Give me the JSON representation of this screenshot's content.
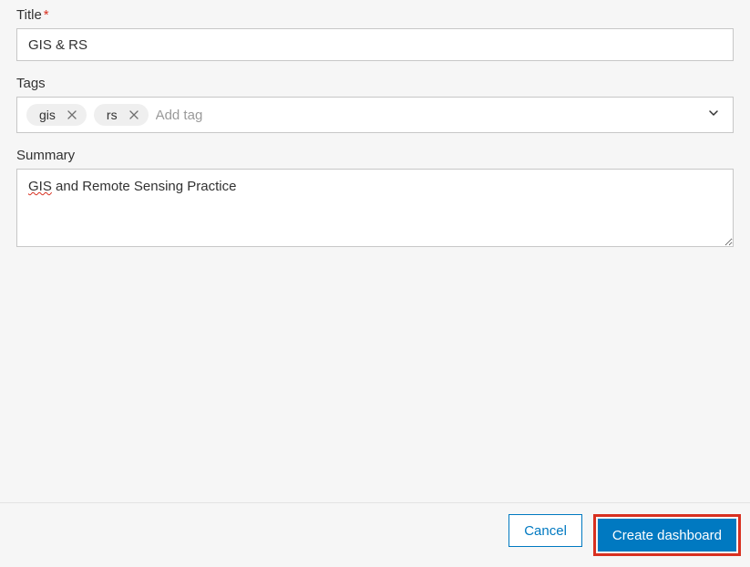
{
  "form": {
    "title": {
      "label": "Title",
      "required_marker": "*",
      "value": "GIS & RS"
    },
    "tags": {
      "label": "Tags",
      "items": [
        {
          "text": "gis"
        },
        {
          "text": "rs"
        }
      ],
      "placeholder": "Add tag"
    },
    "summary": {
      "label": "Summary",
      "value_spellcheck_part": "GIS",
      "value_rest": " and Remote Sensing Practice"
    }
  },
  "footer": {
    "cancel": "Cancel",
    "create": "Create dashboard"
  }
}
